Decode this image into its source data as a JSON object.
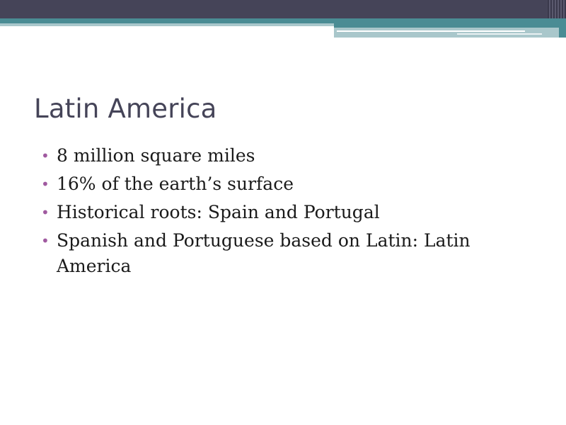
{
  "slide": {
    "title": "Latin America",
    "bullets": [
      "8 million square miles",
      "16% of the earth’s surface",
      "Historical roots: Spain and Portugal",
      "Spanish and Portuguese based on Latin: Latin America"
    ],
    "bullet_glyph": "•",
    "colors": {
      "header_dark": "#454458",
      "header_teal": "#4a8c94",
      "header_light": "#a9c7cb",
      "title": "#454458",
      "bullet": "#a05aa0",
      "body_text": "#1a1a1a"
    }
  }
}
